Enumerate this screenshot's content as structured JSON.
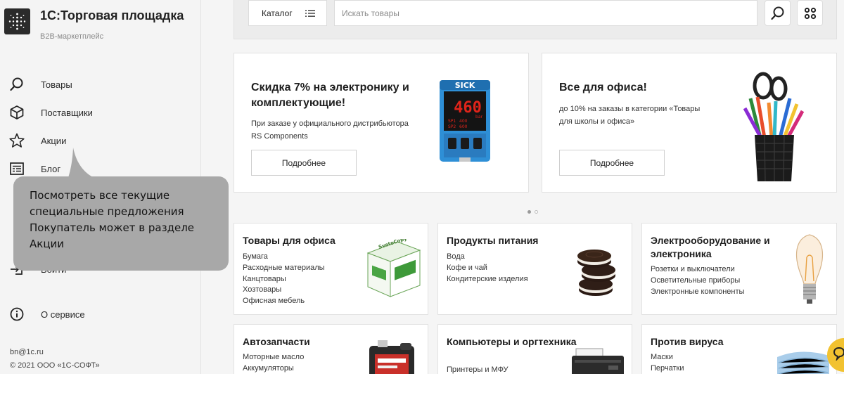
{
  "sidebar": {
    "app_title": "1С:Торговая площадка",
    "app_subtitle": "B2B-маркетплейс",
    "items": [
      {
        "label": "Товары",
        "icon": "search-icon"
      },
      {
        "label": "Поставщики",
        "icon": "box-icon"
      },
      {
        "label": "Акции",
        "icon": "star-icon"
      },
      {
        "label": "Блог",
        "icon": "news-icon"
      },
      {
        "label": "Войти",
        "icon": "login-icon"
      },
      {
        "label": "О сервисе",
        "icon": "info-icon"
      }
    ],
    "footer_email": "bn@1c.ru",
    "footer_copyright": "© 2021 ООО «1С-СОФТ»"
  },
  "search": {
    "catalog_label": "Каталог",
    "placeholder": "Искать товары"
  },
  "banners": [
    {
      "title": "Скидка 7% на электронику и комплектующие!",
      "text": "При заказе у официального дистрибьютора RS Components",
      "button": "Подробнее",
      "device_brand": "SICK",
      "device_value": "460",
      "device_unit": "bar",
      "device_sp1": "SP1",
      "device_sp1_value": "400",
      "device_sp2": "SP2",
      "device_sp2_value": "600"
    },
    {
      "title": "Все для офиса!",
      "text": "до 10% на заказы в категории «Товары для школы и офиса»",
      "button": "Подробнее"
    }
  ],
  "categories": [
    {
      "title": "Товары для офиса",
      "items": [
        "Бумага",
        "Расходные материалы",
        "Канцтовары",
        "Хозтовары",
        "Офисная мебель"
      ],
      "image": "paper-box-image",
      "image_text": "SvetoCopy"
    },
    {
      "title": "Продукты питания",
      "items": [
        "Вода",
        "Кофе и чай",
        "Кондитерские изделия"
      ],
      "image": "cookies-image"
    },
    {
      "title": "Электрооборудование и электроника",
      "items": [
        "Розетки и выключатели",
        "Осветительные приборы",
        "Электронные компоненты"
      ],
      "image": "lightbulb-image"
    },
    {
      "title": "Автозапчасти",
      "items": [
        "Моторные масло",
        "Аккумуляторы"
      ],
      "image": "motor-oil-image"
    },
    {
      "title": "Компьютеры и оргтехника",
      "items": [
        "Принтеры и МФУ"
      ],
      "image": "printer-image"
    },
    {
      "title": "Против вируса",
      "items": [
        "Маски",
        "Перчатки"
      ],
      "image": "face-mask-image"
    }
  ],
  "tooltip": {
    "lines": [
      "Посмотреть все текущие",
      "специальные предложения",
      "Покупатель может в разделе",
      "Акции"
    ]
  },
  "carousel": {
    "count": 2,
    "active": 1
  },
  "colors": {
    "accent_yellow": "#f2c230",
    "tooltip_gray": "#a8a8a8",
    "device_blue": "#2e8fd6",
    "device_red": "#e0241a"
  }
}
